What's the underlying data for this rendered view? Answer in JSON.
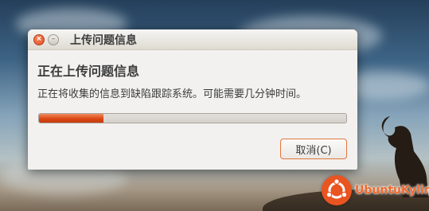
{
  "dialog": {
    "title": "上传问题信息",
    "close_symbol": "×",
    "minimize_symbol": "–",
    "heading": "正在上传问题信息",
    "message": "正在将收集的信息到缺陷跟踪系统。可能需要几分钟时间。",
    "progress": 0.21,
    "cancel_label": "取消(C)"
  },
  "wallpaper": {
    "logo_text": "UbuntuKylin",
    "logo_color": "#e95420"
  },
  "colors": {
    "accent": "#dd4814",
    "window_bg": "#f2f1f0",
    "text": "#3c3c3c"
  }
}
